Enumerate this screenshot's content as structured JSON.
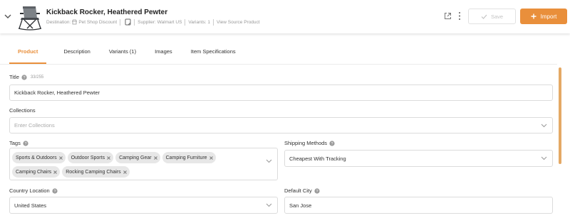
{
  "product": {
    "title": "Kickback Rocker, Heathered Pewter",
    "destination_label": "Destination:",
    "destination_value": "Pet Shop Discount",
    "supplier": "Supplier: Walmart US",
    "variants": "Variants: 1",
    "view_source": "View Source Product"
  },
  "actions": {
    "save_label": "Save",
    "import_label": "Import"
  },
  "tabs": [
    {
      "label": "Product",
      "active": true
    },
    {
      "label": "Description",
      "active": false
    },
    {
      "label": "Variants (1)",
      "active": false
    },
    {
      "label": "Images",
      "active": false
    },
    {
      "label": "Item Specifications",
      "active": false
    }
  ],
  "form": {
    "title_label": "Title",
    "title_count": "33/255",
    "title_value": "Kickback Rocker, Heathered Pewter",
    "collections_label": "Collections",
    "collections_placeholder": "Enter Collections",
    "tags_label": "Tags",
    "tags": [
      "Sports & Outdoors",
      "Outdoor Sports",
      "Camping Gear",
      "Camping Furniture",
      "Camping Chairs",
      "Rocking Camping Chairs"
    ],
    "shipping_label": "Shipping Methods",
    "shipping_value": "Cheapest With Tracking",
    "country_label": "Country Location",
    "country_value": "United States",
    "city_label": "Default City",
    "city_value": "San Jose"
  },
  "colors": {
    "accent": "#e98f3b",
    "tag_bg": "#e7e7e7",
    "border": "#dcdcdc"
  },
  "icons": [
    "chevron-down-icon",
    "store-icon",
    "copy-icon",
    "external-link-icon",
    "more-vertical-icon",
    "check-icon",
    "plus-icon",
    "help-icon",
    "close-icon"
  ]
}
